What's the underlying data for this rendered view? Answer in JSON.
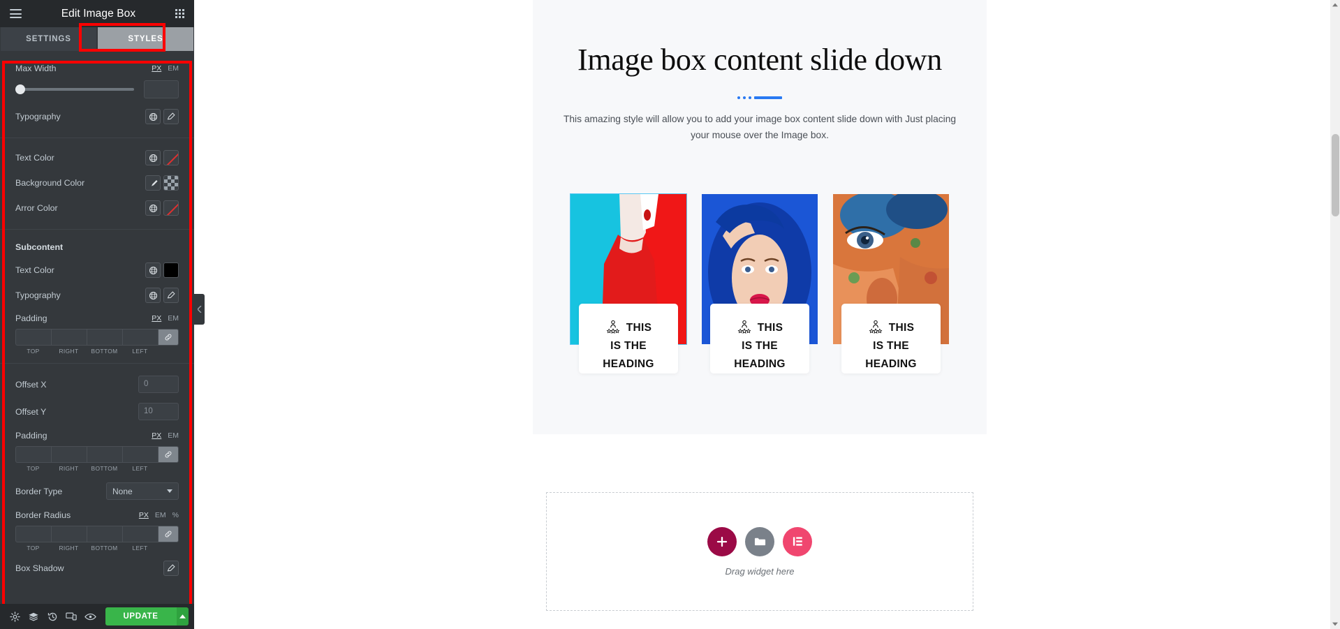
{
  "panel": {
    "header": {
      "title": "Edit Image Box",
      "menu_icon": "hamburger-icon",
      "grid_icon": "widgets-grid-icon"
    },
    "tabs": [
      {
        "label": "SETTINGS",
        "active": false
      },
      {
        "label": "STYLES",
        "active": true
      }
    ],
    "sections": [
      {
        "controls": [
          {
            "label": "Max Width",
            "type": "slider",
            "units": [
              "PX",
              "EM"
            ],
            "active_unit": "PX",
            "value": ""
          },
          {
            "label": "Typography",
            "type": "typography",
            "icons": [
              "globe-icon",
              "pencil-icon"
            ]
          }
        ]
      },
      {
        "controls": [
          {
            "label": "Text Color",
            "type": "color",
            "icons": [
              "globe-icon"
            ],
            "swatch": "none"
          },
          {
            "label": "Background Color",
            "type": "color",
            "icons": [
              "brush-icon"
            ],
            "swatch": "checker"
          },
          {
            "label": "Arror Color",
            "type": "color",
            "icons": [
              "globe-icon"
            ],
            "swatch": "none"
          }
        ]
      },
      {
        "heading": "Subcontent",
        "controls": [
          {
            "label": "Text Color",
            "type": "color",
            "icons": [
              "globe-icon"
            ],
            "swatch": "black"
          },
          {
            "label": "Typography",
            "type": "typography",
            "icons": [
              "globe-icon",
              "pencil-icon"
            ]
          },
          {
            "label": "Padding",
            "type": "dimensions",
            "units": [
              "PX",
              "EM"
            ],
            "active_unit": "PX",
            "sides": [
              "TOP",
              "RIGHT",
              "BOTTOM",
              "LEFT"
            ],
            "values": [
              "",
              "",
              "",
              ""
            ],
            "link_icon": "link-icon"
          }
        ]
      },
      {
        "controls": [
          {
            "label": "Offset X",
            "type": "number",
            "value": "",
            "placeholder": "0"
          },
          {
            "label": "Offset Y",
            "type": "number",
            "value": "",
            "placeholder": "10"
          },
          {
            "label": "Padding",
            "type": "dimensions",
            "units": [
              "PX",
              "EM"
            ],
            "active_unit": "PX",
            "sides": [
              "TOP",
              "RIGHT",
              "BOTTOM",
              "LEFT"
            ],
            "values": [
              "",
              "",
              "",
              ""
            ],
            "link_icon": "link-icon"
          },
          {
            "label": "Border Type",
            "type": "select",
            "value": "None"
          },
          {
            "label": "Border Radius",
            "type": "dimensions",
            "units": [
              "PX",
              "EM",
              "%"
            ],
            "active_unit": "PX",
            "sides": [
              "TOP",
              "RIGHT",
              "BOTTOM",
              "LEFT"
            ],
            "values": [
              "",
              "",
              "",
              ""
            ],
            "link_icon": "link-icon"
          },
          {
            "label": "Box Shadow",
            "type": "shadow",
            "icons": [
              "pencil-icon"
            ]
          }
        ]
      }
    ],
    "footer": {
      "icons": [
        "gear-icon",
        "layers-icon",
        "history-icon",
        "responsive-icon",
        "preview-eye-icon"
      ],
      "update_label": "UPDATE",
      "update_caret": "chevron-up-icon"
    },
    "highlight_color": "#fe0000"
  },
  "canvas": {
    "hero": {
      "title": "Image box content slide down",
      "divider": {
        "dots": 3,
        "color": "#2979f2"
      },
      "subtitle": "This amazing style will allow you to add your image box content slide down with Just placing your mouse over the Image box."
    },
    "cards": [
      {
        "heading_line1": "THIS",
        "heading_line2": "IS THE",
        "heading_line3": "HEADING",
        "icon": "person-stars-icon",
        "selected": true
      },
      {
        "heading_line1": "THIS",
        "heading_line2": "IS THE",
        "heading_line3": "HEADING",
        "icon": "person-stars-icon",
        "selected": false
      },
      {
        "heading_line1": "THIS",
        "heading_line2": "IS THE",
        "heading_line3": "HEADING",
        "icon": "person-stars-icon",
        "selected": false
      }
    ],
    "dropzone": {
      "text": "Drag widget here",
      "buttons": [
        {
          "name": "add-section-button",
          "icon": "plus-icon",
          "color": "#9b0a46"
        },
        {
          "name": "add-template-folder-button",
          "icon": "folder-icon",
          "color": "#7a818a"
        },
        {
          "name": "elementor-template-button",
          "icon": "elementor-k-icon",
          "color": "#f0466f"
        }
      ]
    }
  },
  "collapse_handle": {
    "icon": "chevron-left-icon"
  }
}
